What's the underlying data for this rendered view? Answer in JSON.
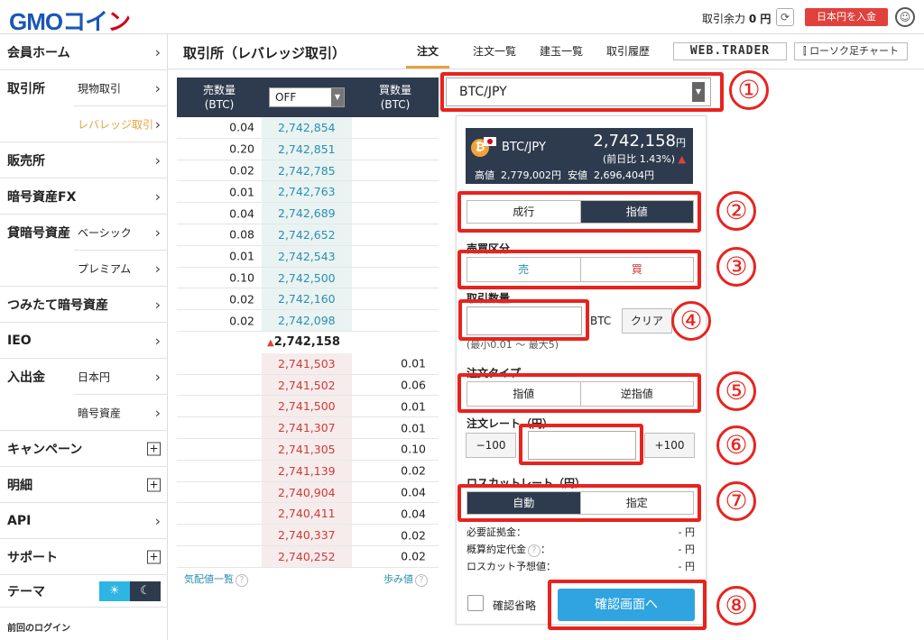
{
  "header": {
    "logo_main": "GMOコイ",
    "logo_accent": "ン",
    "balance_label": "取引余力",
    "balance_value": "0 円",
    "deposit_button": "日本円を入金"
  },
  "sidebar": {
    "member_home": "会員ホーム",
    "exchange": "取引所",
    "spot_trade": "現物取引",
    "leverage_trade": "レバレッジ取引",
    "sales": "販売所",
    "crypto_fx": "暗号資産FX",
    "lending": "貸暗号資産",
    "basic": "ベーシック",
    "premium": "プレミアム",
    "tsumitate": "つみたて暗号資産",
    "ieo": "IEO",
    "deposit_withdraw": "入出金",
    "jpy": "日本円",
    "crypto": "暗号資産",
    "campaign": "キャンペーン",
    "statement": "明細",
    "api": "API",
    "support": "サポート",
    "theme": "テーマ",
    "last_login": "前回のログイン"
  },
  "main": {
    "title": "取引所（レバレッジ取引）",
    "tabs": [
      "注文",
      "注文一覧",
      "建玉一覧",
      "取引履歴"
    ],
    "webtrader": "WEB.TRADER",
    "candle_chart": "ローソク足チャート"
  },
  "orderbook": {
    "sell_header": "売数量\n(BTC)",
    "buy_header": "買数量\n(BTC)",
    "select_value": "OFF",
    "asks": [
      {
        "qty": "0.04",
        "price": "2,742,854"
      },
      {
        "qty": "0.20",
        "price": "2,742,851"
      },
      {
        "qty": "0.02",
        "price": "2,742,785"
      },
      {
        "qty": "0.01",
        "price": "2,742,763"
      },
      {
        "qty": "0.04",
        "price": "2,742,689"
      },
      {
        "qty": "0.08",
        "price": "2,742,652"
      },
      {
        "qty": "0.01",
        "price": "2,742,543"
      },
      {
        "qty": "0.10",
        "price": "2,742,500"
      },
      {
        "qty": "0.02",
        "price": "2,742,160"
      },
      {
        "qty": "0.02",
        "price": "2,742,098"
      }
    ],
    "mid_price": "2,742,158",
    "bids": [
      {
        "qty": "0.01",
        "price": "2,741,503"
      },
      {
        "qty": "0.06",
        "price": "2,741,502"
      },
      {
        "qty": "0.01",
        "price": "2,741,500"
      },
      {
        "qty": "0.01",
        "price": "2,741,307"
      },
      {
        "qty": "0.10",
        "price": "2,741,305"
      },
      {
        "qty": "0.02",
        "price": "2,741,139"
      },
      {
        "qty": "0.04",
        "price": "2,740,904"
      },
      {
        "qty": "0.04",
        "price": "2,740,411"
      },
      {
        "qty": "0.02",
        "price": "2,740,337"
      },
      {
        "qty": "0.02",
        "price": "2,740,252"
      }
    ],
    "board_list": "気配値一覧",
    "tick_history": "歩み値"
  },
  "order": {
    "symbol": "BTC/JPY",
    "ticker": {
      "symbol": "BTC/JPY",
      "price": "2,742,158",
      "price_unit": "円",
      "change": "(前日比 1.43%)",
      "high_label": "高値",
      "high": "2,779,002円",
      "low_label": "安値",
      "low": "2,696,404円"
    },
    "exec_type": [
      "成行",
      "指値"
    ],
    "side_label": "売買区分",
    "side": [
      "売",
      "買"
    ],
    "qty_label": "取引数量",
    "qty_value": "",
    "qty_unit": "BTC",
    "clear_button": "クリア",
    "qty_range": "(最小0.01 〜 最大5)",
    "order_type_label": "注文タイプ",
    "order_type": [
      "指値",
      "逆指値"
    ],
    "rate_label": "注文レート（円）",
    "rate_minus": "−100",
    "rate_plus": "+100",
    "rate_value": "",
    "losscut_label": "ロスカットレート（円）",
    "losscut": [
      "自動",
      "指定"
    ],
    "margin_label": "必要証拠金：",
    "margin_value": "- 円",
    "contract_label": "概算約定代金",
    "contract_value": "- 円",
    "losscut_est_label": "ロスカット予想値：",
    "losscut_est_value": "- 円",
    "skip_confirm": "確認省略",
    "confirm_button": "確認画面へ"
  },
  "annotations": [
    "①",
    "②",
    "③",
    "④",
    "⑤",
    "⑥",
    "⑦",
    "⑧"
  ],
  "colors": {
    "annotation_red": "#e8231e",
    "accent_orange": "#e3a33c",
    "dark_navy": "#2e3b4e",
    "ask_blue": "#2a8fb0",
    "bid_red": "#cf3a36",
    "confirm_blue": "#2fa4e0"
  }
}
